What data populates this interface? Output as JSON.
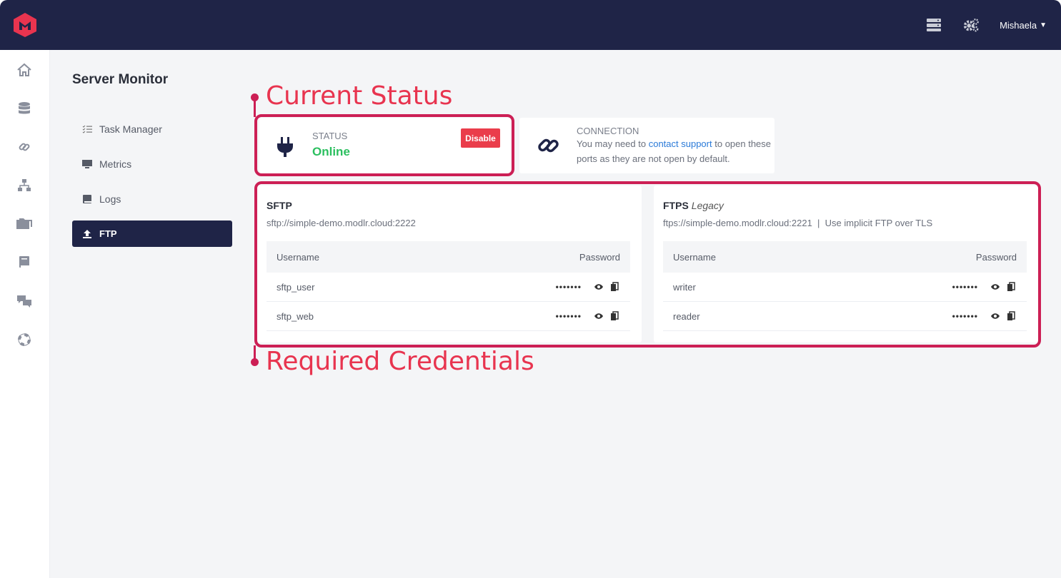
{
  "user": {
    "name": "Mishaela"
  },
  "page": {
    "title": "Server Monitor"
  },
  "submenu": [
    {
      "label": "Task Manager",
      "icon": "tasks-icon"
    },
    {
      "label": "Metrics",
      "icon": "monitor-icon"
    },
    {
      "label": "Logs",
      "icon": "book-icon"
    },
    {
      "label": "FTP",
      "icon": "upload-icon",
      "active": true
    }
  ],
  "status_card": {
    "label": "STATUS",
    "value": "Online",
    "action": "Disable"
  },
  "connection_card": {
    "label": "CONNECTION",
    "text_before": "You may need to",
    "link": "contact support",
    "text_after": "to open these ports as they are not open by default."
  },
  "sftp": {
    "title": "SFTP",
    "url": "sftp://simple-demo.modlr.cloud:2222",
    "col_username": "Username",
    "col_password": "Password",
    "rows": [
      {
        "username": "sftp_user",
        "password": "•••••••"
      },
      {
        "username": "sftp_web",
        "password": "•••••••"
      }
    ]
  },
  "ftps": {
    "title": "FTPS",
    "subtitle": "Legacy",
    "url": "ftps://simple-demo.modlr.cloud:2221  |  Use implicit FTP over TLS",
    "col_username": "Username",
    "col_password": "Password",
    "rows": [
      {
        "username": "writer",
        "password": "•••••••"
      },
      {
        "username": "reader",
        "password": "•••••••"
      }
    ]
  },
  "annotations": {
    "current_status": "Current Status",
    "required_credentials": "Required Credentials"
  },
  "colors": {
    "topbar": "#1f2447",
    "brand": "#e8344f",
    "annotation": "#cc1f55",
    "online": "#2bbf5f",
    "disable": "#ea3d4b",
    "link": "#2a7ad8"
  }
}
